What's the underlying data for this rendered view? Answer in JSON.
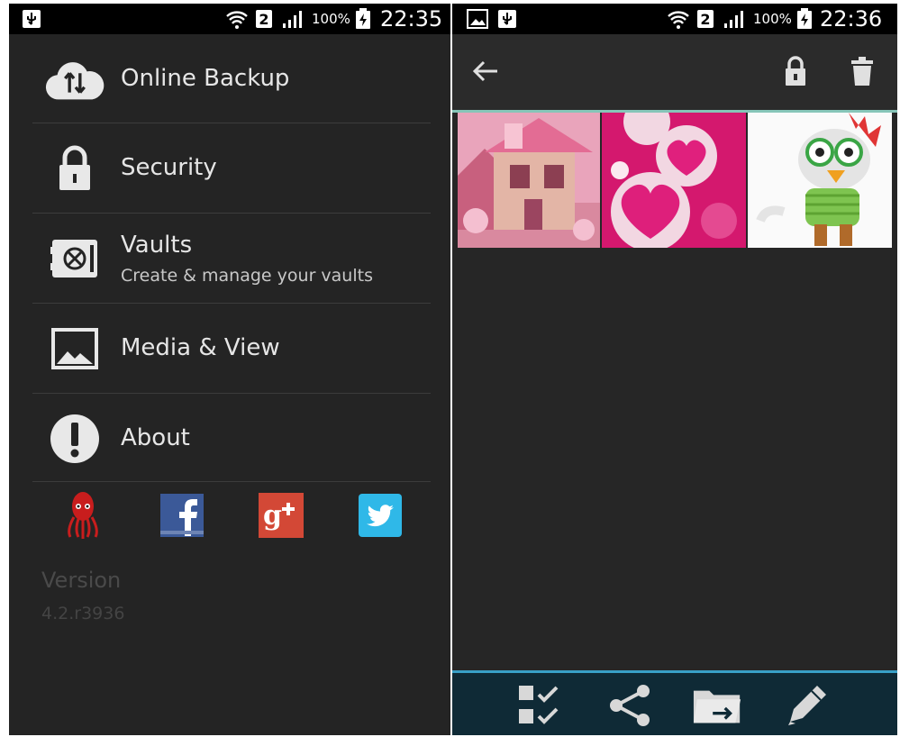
{
  "left": {
    "status": {
      "battery": "100%",
      "time": "22:35",
      "sim": "2"
    },
    "menu": [
      {
        "icon": "cloud-sync-icon",
        "label": "Online Backup"
      },
      {
        "icon": "lock-icon",
        "label": "Security"
      },
      {
        "icon": "vault-icon",
        "label": "Vaults",
        "sub": "Create & manage your vaults"
      },
      {
        "icon": "image-icon",
        "label": "Media & View"
      },
      {
        "icon": "info-exclamation-icon",
        "label": "About"
      }
    ],
    "social": [
      "squid-mascot-icon",
      "facebook-icon",
      "google-plus-icon",
      "twitter-icon"
    ],
    "version": {
      "label": "Version",
      "number": "4.2.r3936"
    }
  },
  "right": {
    "status": {
      "battery": "100%",
      "time": "22:36",
      "sim": "2"
    },
    "toolbar": [
      "back-arrow-icon",
      "lock-icon",
      "trash-icon"
    ],
    "thumbnails": [
      "pink-cottage-photo",
      "pink-hearts-photo",
      "cartoon-chicken-photo"
    ],
    "bottom_actions": [
      "select-all-checklist-icon",
      "share-icon",
      "move-folder-icon",
      "edit-pencil-icon"
    ]
  },
  "colors": {
    "bg": "#242424",
    "accent_line": "#86c5b8",
    "bottombar": "#0f2a36",
    "bottombar_border": "#38a0c8"
  }
}
